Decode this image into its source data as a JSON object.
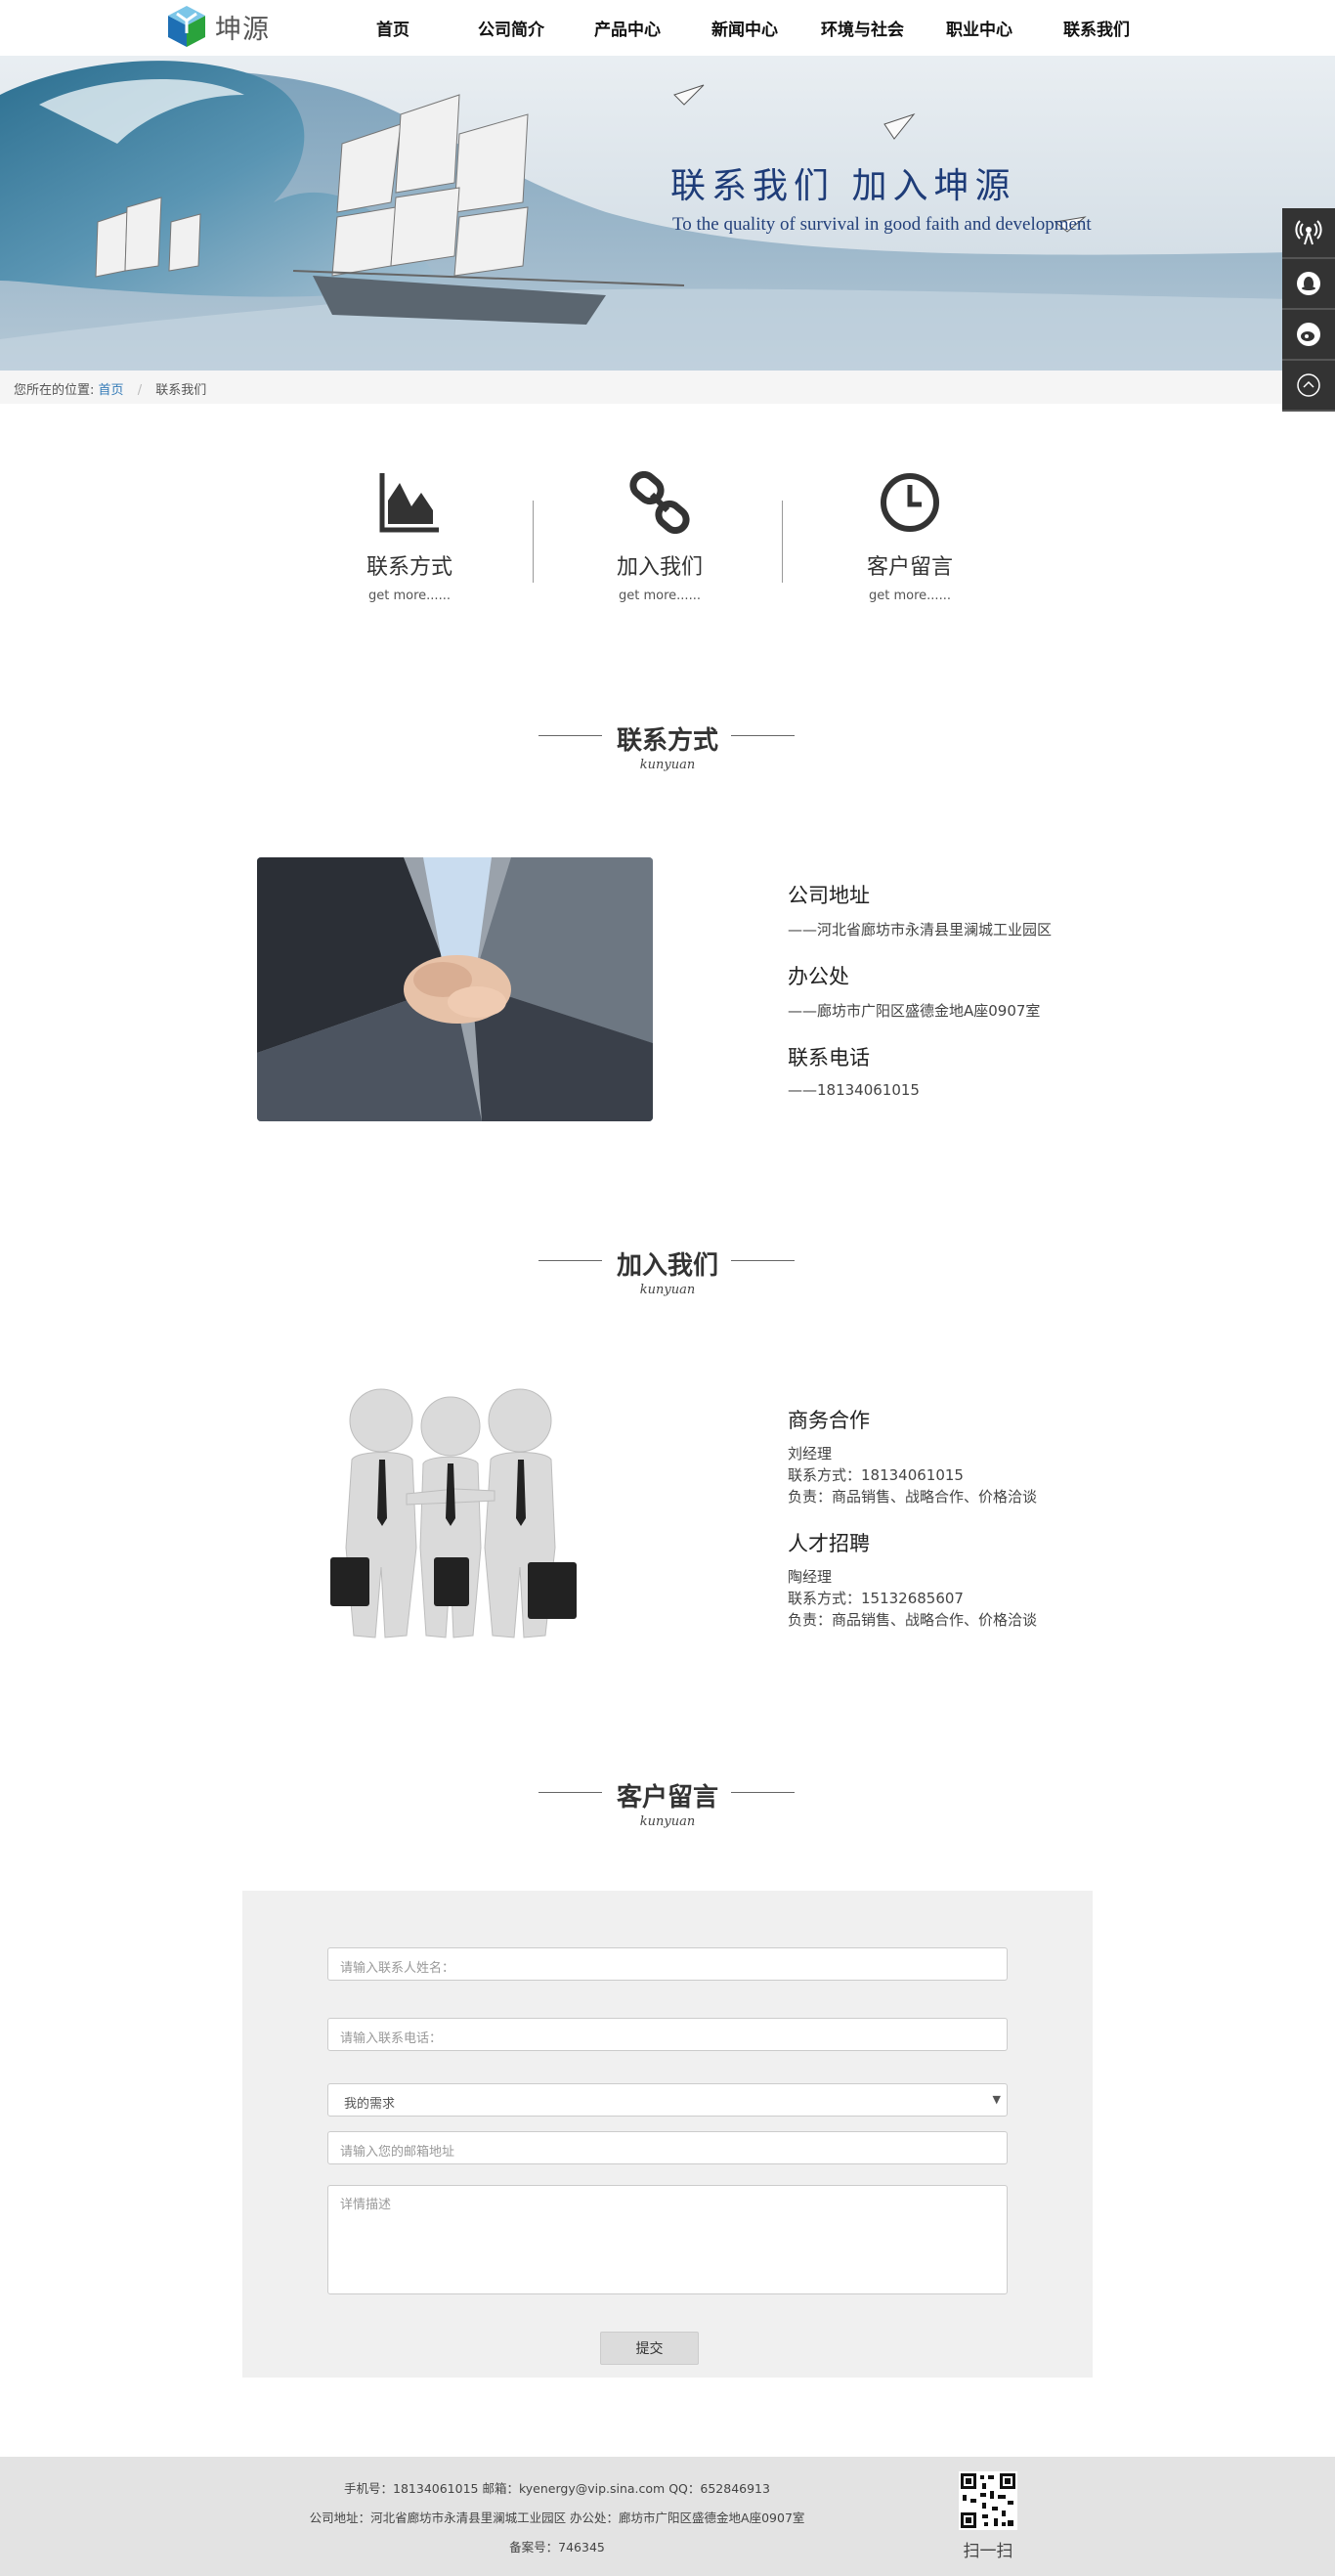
{
  "header": {
    "logo_text": "坤源",
    "nav": [
      "首页",
      "公司简介",
      "产品中心",
      "新闻中心",
      "环境与社会",
      "职业中心",
      "联系我们"
    ]
  },
  "banner": {
    "title": "联系我们  加入坤源",
    "subtitle": "To the quality of survival in good faith and development"
  },
  "breadcrumb": {
    "prefix": "您所在的位置:",
    "home": "首页",
    "current": "联系我们"
  },
  "sidebar": {
    "icons": [
      "broadcast-icon",
      "qq-penguin-icon",
      "weibo-icon",
      "back-to-top-icon"
    ]
  },
  "tiles": [
    {
      "title": "联系方式",
      "more": "get more......",
      "icon": "area-chart-icon"
    },
    {
      "title": "加入我们",
      "more": "get more......",
      "icon": "chain-link-icon"
    },
    {
      "title": "客户留言",
      "more": "get more......",
      "icon": "clock-icon"
    }
  ],
  "contact": {
    "heading": "联系方式",
    "heading_sub": "kunyuan",
    "items": [
      {
        "label": "公司地址",
        "value": "——河北省廊坊市永清县里澜城工业园区"
      },
      {
        "label": "办公处",
        "value": "——廊坊市广阳区盛德金地A座0907室"
      },
      {
        "label": "联系电话",
        "value": "——18134061015"
      }
    ]
  },
  "join": {
    "heading": "加入我们",
    "heading_sub": "kunyuan",
    "groups": [
      {
        "label": "商务合作",
        "lines": [
          "刘经理",
          "联系方式：18134061015",
          "负责：商品销售、战略合作、价格洽谈"
        ]
      },
      {
        "label": "人才招聘",
        "lines": [
          "陶经理",
          "联系方式：15132685607",
          "负责：商品销售、战略合作、价格洽谈"
        ]
      }
    ]
  },
  "message": {
    "heading": "客户留言",
    "heading_sub": "kunyuan",
    "name_placeholder": "请输入联系人姓名：",
    "phone_placeholder": "请输入联系电话：",
    "need_selected": "我的需求",
    "email_placeholder": "请输入您的邮箱地址",
    "detail_placeholder": "详情描述",
    "submit_label": "提交"
  },
  "footer": {
    "line1": "手机号：18134061015    邮箱：kyenergy@vip.sina.com    QQ：652846913",
    "line2": "公司地址：河北省廊坊市永清县里澜城工业园区    办公处：廊坊市广阳区盛德金地A座0907室",
    "line3": "备案号：746345",
    "qr_label": "扫一扫"
  },
  "colors": {
    "accent_link": "#337ab7",
    "banner_title": "#1e3c78",
    "sidebar_bg": "#333333",
    "footer_bg": "#e3e3e3",
    "logo_blue": "#1e6fb4",
    "logo_green": "#2aa33c"
  }
}
